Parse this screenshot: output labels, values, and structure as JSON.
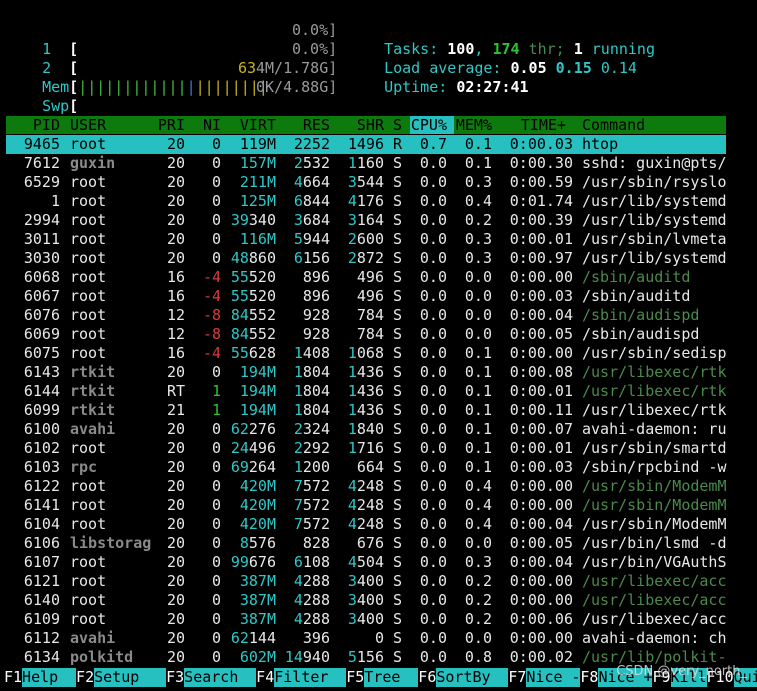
{
  "meters": {
    "cpu1": {
      "label": "1",
      "value": "0.0%]"
    },
    "cpu2": {
      "label": "2",
      "value": "0.0%]"
    },
    "mem": {
      "label": "Mem",
      "value": "634M/1.78G]"
    },
    "swp": {
      "label": "Swp",
      "value": "0K/4.88G]"
    }
  },
  "summary": {
    "tasks_label": "Tasks:",
    "tasks": "100",
    "threads": "174",
    "thr_label": "thr;",
    "running": "1",
    "running_label": "running",
    "load_label": "Load average:",
    "load1": "0.05",
    "load5": "0.15",
    "load15": "0.14",
    "uptime_label": "Uptime:",
    "uptime": "02:27:41"
  },
  "columns": [
    "PID",
    "USER",
    "PRI",
    "NI",
    "VIRT",
    "RES",
    "SHR",
    "S",
    "CPU%",
    "MEM%",
    "TIME+",
    "Command"
  ],
  "processes": [
    {
      "pid": "9465",
      "user": "root",
      "pri": "20",
      "ni": "0",
      "virt": "119M",
      "res": "2252",
      "shr": "1496",
      "s": "R",
      "cpu": "0.7",
      "mem": "0.1",
      "time": "0:00.03",
      "cmd": "htop",
      "selected": true
    },
    {
      "pid": "7612",
      "user": "guxin",
      "pri": "20",
      "ni": "0",
      "virt": "157M",
      "res": "2532",
      "shr": "1160",
      "s": "S",
      "cpu": "0.0",
      "mem": "0.1",
      "time": "0:00.30",
      "cmd": "sshd: guxin@pts/"
    },
    {
      "pid": "6529",
      "user": "root",
      "pri": "20",
      "ni": "0",
      "virt": "211M",
      "res": "4664",
      "shr": "3544",
      "s": "S",
      "cpu": "0.0",
      "mem": "0.3",
      "time": "0:00.59",
      "cmd": "/usr/sbin/rsyslo"
    },
    {
      "pid": "1",
      "user": "root",
      "pri": "20",
      "ni": "0",
      "virt": "125M",
      "res": "6844",
      "shr": "4176",
      "s": "S",
      "cpu": "0.0",
      "mem": "0.4",
      "time": "0:01.74",
      "cmd": "/usr/lib/systemd"
    },
    {
      "pid": "2994",
      "user": "root",
      "pri": "20",
      "ni": "0",
      "virt": "39340",
      "res": "3684",
      "shr": "3164",
      "s": "S",
      "cpu": "0.0",
      "mem": "0.2",
      "time": "0:00.39",
      "cmd": "/usr/lib/systemd"
    },
    {
      "pid": "3011",
      "user": "root",
      "pri": "20",
      "ni": "0",
      "virt": "116M",
      "res": "5944",
      "shr": "2600",
      "s": "S",
      "cpu": "0.0",
      "mem": "0.3",
      "time": "0:00.01",
      "cmd": "/usr/sbin/lvmeta"
    },
    {
      "pid": "3030",
      "user": "root",
      "pri": "20",
      "ni": "0",
      "virt": "48860",
      "res": "6156",
      "shr": "2872",
      "s": "S",
      "cpu": "0.0",
      "mem": "0.3",
      "time": "0:00.97",
      "cmd": "/usr/lib/systemd"
    },
    {
      "pid": "6068",
      "user": "root",
      "pri": "16",
      "ni": "-4",
      "virt": "55520",
      "res": "896",
      "shr": "496",
      "s": "S",
      "cpu": "0.0",
      "mem": "0.0",
      "time": "0:00.00",
      "cmd": "/sbin/auditd",
      "dim": true
    },
    {
      "pid": "6067",
      "user": "root",
      "pri": "16",
      "ni": "-4",
      "virt": "55520",
      "res": "896",
      "shr": "496",
      "s": "S",
      "cpu": "0.0",
      "mem": "0.0",
      "time": "0:00.03",
      "cmd": "/sbin/auditd"
    },
    {
      "pid": "6076",
      "user": "root",
      "pri": "12",
      "ni": "-8",
      "virt": "84552",
      "res": "928",
      "shr": "784",
      "s": "S",
      "cpu": "0.0",
      "mem": "0.0",
      "time": "0:00.04",
      "cmd": "/sbin/audispd",
      "dim": true
    },
    {
      "pid": "6069",
      "user": "root",
      "pri": "12",
      "ni": "-8",
      "virt": "84552",
      "res": "928",
      "shr": "784",
      "s": "S",
      "cpu": "0.0",
      "mem": "0.0",
      "time": "0:00.05",
      "cmd": "/sbin/audispd"
    },
    {
      "pid": "6075",
      "user": "root",
      "pri": "16",
      "ni": "-4",
      "virt": "55628",
      "res": "1408",
      "shr": "1068",
      "s": "S",
      "cpu": "0.0",
      "mem": "0.1",
      "time": "0:00.00",
      "cmd": "/usr/sbin/sedisp"
    },
    {
      "pid": "6143",
      "user": "rtkit",
      "pri": "20",
      "ni": "0",
      "virt": "194M",
      "res": "1804",
      "shr": "1436",
      "s": "S",
      "cpu": "0.0",
      "mem": "0.1",
      "time": "0:00.08",
      "cmd": "/usr/libexec/rtk",
      "dim": true
    },
    {
      "pid": "6144",
      "user": "rtkit",
      "pri": "RT",
      "ni": "1",
      "virt": "194M",
      "res": "1804",
      "shr": "1436",
      "s": "S",
      "cpu": "0.0",
      "mem": "0.1",
      "time": "0:00.01",
      "cmd": "/usr/libexec/rtk",
      "dim": true
    },
    {
      "pid": "6099",
      "user": "rtkit",
      "pri": "21",
      "ni": "1",
      "virt": "194M",
      "res": "1804",
      "shr": "1436",
      "s": "S",
      "cpu": "0.0",
      "mem": "0.1",
      "time": "0:00.11",
      "cmd": "/usr/libexec/rtk"
    },
    {
      "pid": "6100",
      "user": "avahi",
      "pri": "20",
      "ni": "0",
      "virt": "62276",
      "res": "2324",
      "shr": "1840",
      "s": "S",
      "cpu": "0.0",
      "mem": "0.1",
      "time": "0:00.07",
      "cmd": "avahi-daemon: ru"
    },
    {
      "pid": "6102",
      "user": "root",
      "pri": "20",
      "ni": "0",
      "virt": "24496",
      "res": "2292",
      "shr": "1716",
      "s": "S",
      "cpu": "0.0",
      "mem": "0.1",
      "time": "0:00.01",
      "cmd": "/usr/sbin/smartd"
    },
    {
      "pid": "6103",
      "user": "rpc",
      "pri": "20",
      "ni": "0",
      "virt": "69264",
      "res": "1200",
      "shr": "664",
      "s": "S",
      "cpu": "0.0",
      "mem": "0.1",
      "time": "0:00.03",
      "cmd": "/sbin/rpcbind -w"
    },
    {
      "pid": "6122",
      "user": "root",
      "pri": "20",
      "ni": "0",
      "virt": "420M",
      "res": "7572",
      "shr": "4248",
      "s": "S",
      "cpu": "0.0",
      "mem": "0.4",
      "time": "0:00.00",
      "cmd": "/usr/sbin/ModemM",
      "dim": true
    },
    {
      "pid": "6141",
      "user": "root",
      "pri": "20",
      "ni": "0",
      "virt": "420M",
      "res": "7572",
      "shr": "4248",
      "s": "S",
      "cpu": "0.0",
      "mem": "0.4",
      "time": "0:00.00",
      "cmd": "/usr/sbin/ModemM",
      "dim": true
    },
    {
      "pid": "6104",
      "user": "root",
      "pri": "20",
      "ni": "0",
      "virt": "420M",
      "res": "7572",
      "shr": "4248",
      "s": "S",
      "cpu": "0.0",
      "mem": "0.4",
      "time": "0:00.04",
      "cmd": "/usr/sbin/ModemM"
    },
    {
      "pid": "6106",
      "user": "libstorag",
      "pri": "20",
      "ni": "0",
      "virt": "8576",
      "res": "828",
      "shr": "676",
      "s": "S",
      "cpu": "0.0",
      "mem": "0.0",
      "time": "0:00.05",
      "cmd": "/usr/bin/lsmd -d"
    },
    {
      "pid": "6107",
      "user": "root",
      "pri": "20",
      "ni": "0",
      "virt": "99676",
      "res": "6108",
      "shr": "4504",
      "s": "S",
      "cpu": "0.0",
      "mem": "0.3",
      "time": "0:00.04",
      "cmd": "/usr/bin/VGAuthS"
    },
    {
      "pid": "6121",
      "user": "root",
      "pri": "20",
      "ni": "0",
      "virt": "387M",
      "res": "4288",
      "shr": "3400",
      "s": "S",
      "cpu": "0.0",
      "mem": "0.2",
      "time": "0:00.00",
      "cmd": "/usr/libexec/acc",
      "dim": true
    },
    {
      "pid": "6140",
      "user": "root",
      "pri": "20",
      "ni": "0",
      "virt": "387M",
      "res": "4288",
      "shr": "3400",
      "s": "S",
      "cpu": "0.0",
      "mem": "0.2",
      "time": "0:00.00",
      "cmd": "/usr/libexec/acc",
      "dim": true
    },
    {
      "pid": "6109",
      "user": "root",
      "pri": "20",
      "ni": "0",
      "virt": "387M",
      "res": "4288",
      "shr": "3400",
      "s": "S",
      "cpu": "0.0",
      "mem": "0.2",
      "time": "0:00.06",
      "cmd": "/usr/libexec/acc"
    },
    {
      "pid": "6112",
      "user": "avahi",
      "pri": "20",
      "ni": "0",
      "virt": "62144",
      "res": "396",
      "shr": "0",
      "s": "S",
      "cpu": "0.0",
      "mem": "0.0",
      "time": "0:00.00",
      "cmd": "avahi-daemon: ch"
    },
    {
      "pid": "6134",
      "user": "polkitd",
      "pri": "20",
      "ni": "0",
      "virt": "602M",
      "res": "14940",
      "shr": "5156",
      "s": "S",
      "cpu": "0.0",
      "mem": "0.8",
      "time": "0:00.02",
      "cmd": "/usr/lib/polkit-",
      "dim": true
    }
  ],
  "fkeys": [
    {
      "key": "F1",
      "label": "Help"
    },
    {
      "key": "F2",
      "label": "Setup"
    },
    {
      "key": "F3",
      "label": "Search"
    },
    {
      "key": "F4",
      "label": "Filter"
    },
    {
      "key": "F5",
      "label": "Tree"
    },
    {
      "key": "F6",
      "label": "SortBy"
    },
    {
      "key": "F7",
      "label": "Nice -"
    },
    {
      "key": "F8",
      "label": "Nice +"
    },
    {
      "key": "F9",
      "label": "Kill"
    },
    {
      "key": "F10",
      "label": "Quit"
    }
  ],
  "watermark": "CSDN @very_north_",
  "colors": {
    "header_bg": "#0d7a0d",
    "selection_bg": "#26c0c0",
    "cyan": "#2ec8c8",
    "dim_cmd": "#4a8a4a"
  }
}
